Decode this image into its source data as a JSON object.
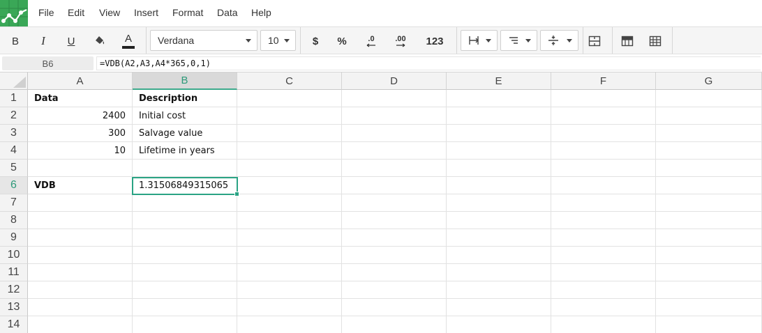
{
  "menu": {
    "items": [
      "File",
      "Edit",
      "View",
      "Insert",
      "Format",
      "Data",
      "Help"
    ]
  },
  "toolbar": {
    "bold": "B",
    "italic": "I",
    "underline": "U",
    "font_color_glyph": "A",
    "font_family": "Verdana",
    "font_size": "10",
    "currency": "$",
    "percent": "%",
    "decrease_decimals": ".0",
    "increase_decimals": ".00",
    "number_format": "123"
  },
  "formula_bar": {
    "cell_ref": "B6",
    "formula": "=VDB(A2,A3,A4*365,0,1)"
  },
  "grid": {
    "columns": [
      "A",
      "B",
      "C",
      "D",
      "E",
      "F",
      "G"
    ],
    "rows": [
      "1",
      "2",
      "3",
      "4",
      "5",
      "6",
      "7",
      "8",
      "9",
      "10",
      "11",
      "12",
      "13",
      "14"
    ],
    "active_column": "B",
    "active_row": "6",
    "cells": {
      "A1": "Data",
      "B1": "Description",
      "A2": "2400",
      "B2": "Initial cost",
      "A3": "300",
      "B3": "Salvage value",
      "A4": "10",
      "B4": "Lifetime in years",
      "A6": "VDB",
      "B6": "1.31506849315065"
    }
  },
  "colors": {
    "logo_green": "#3aa757",
    "accent_teal": "#2aa384"
  }
}
